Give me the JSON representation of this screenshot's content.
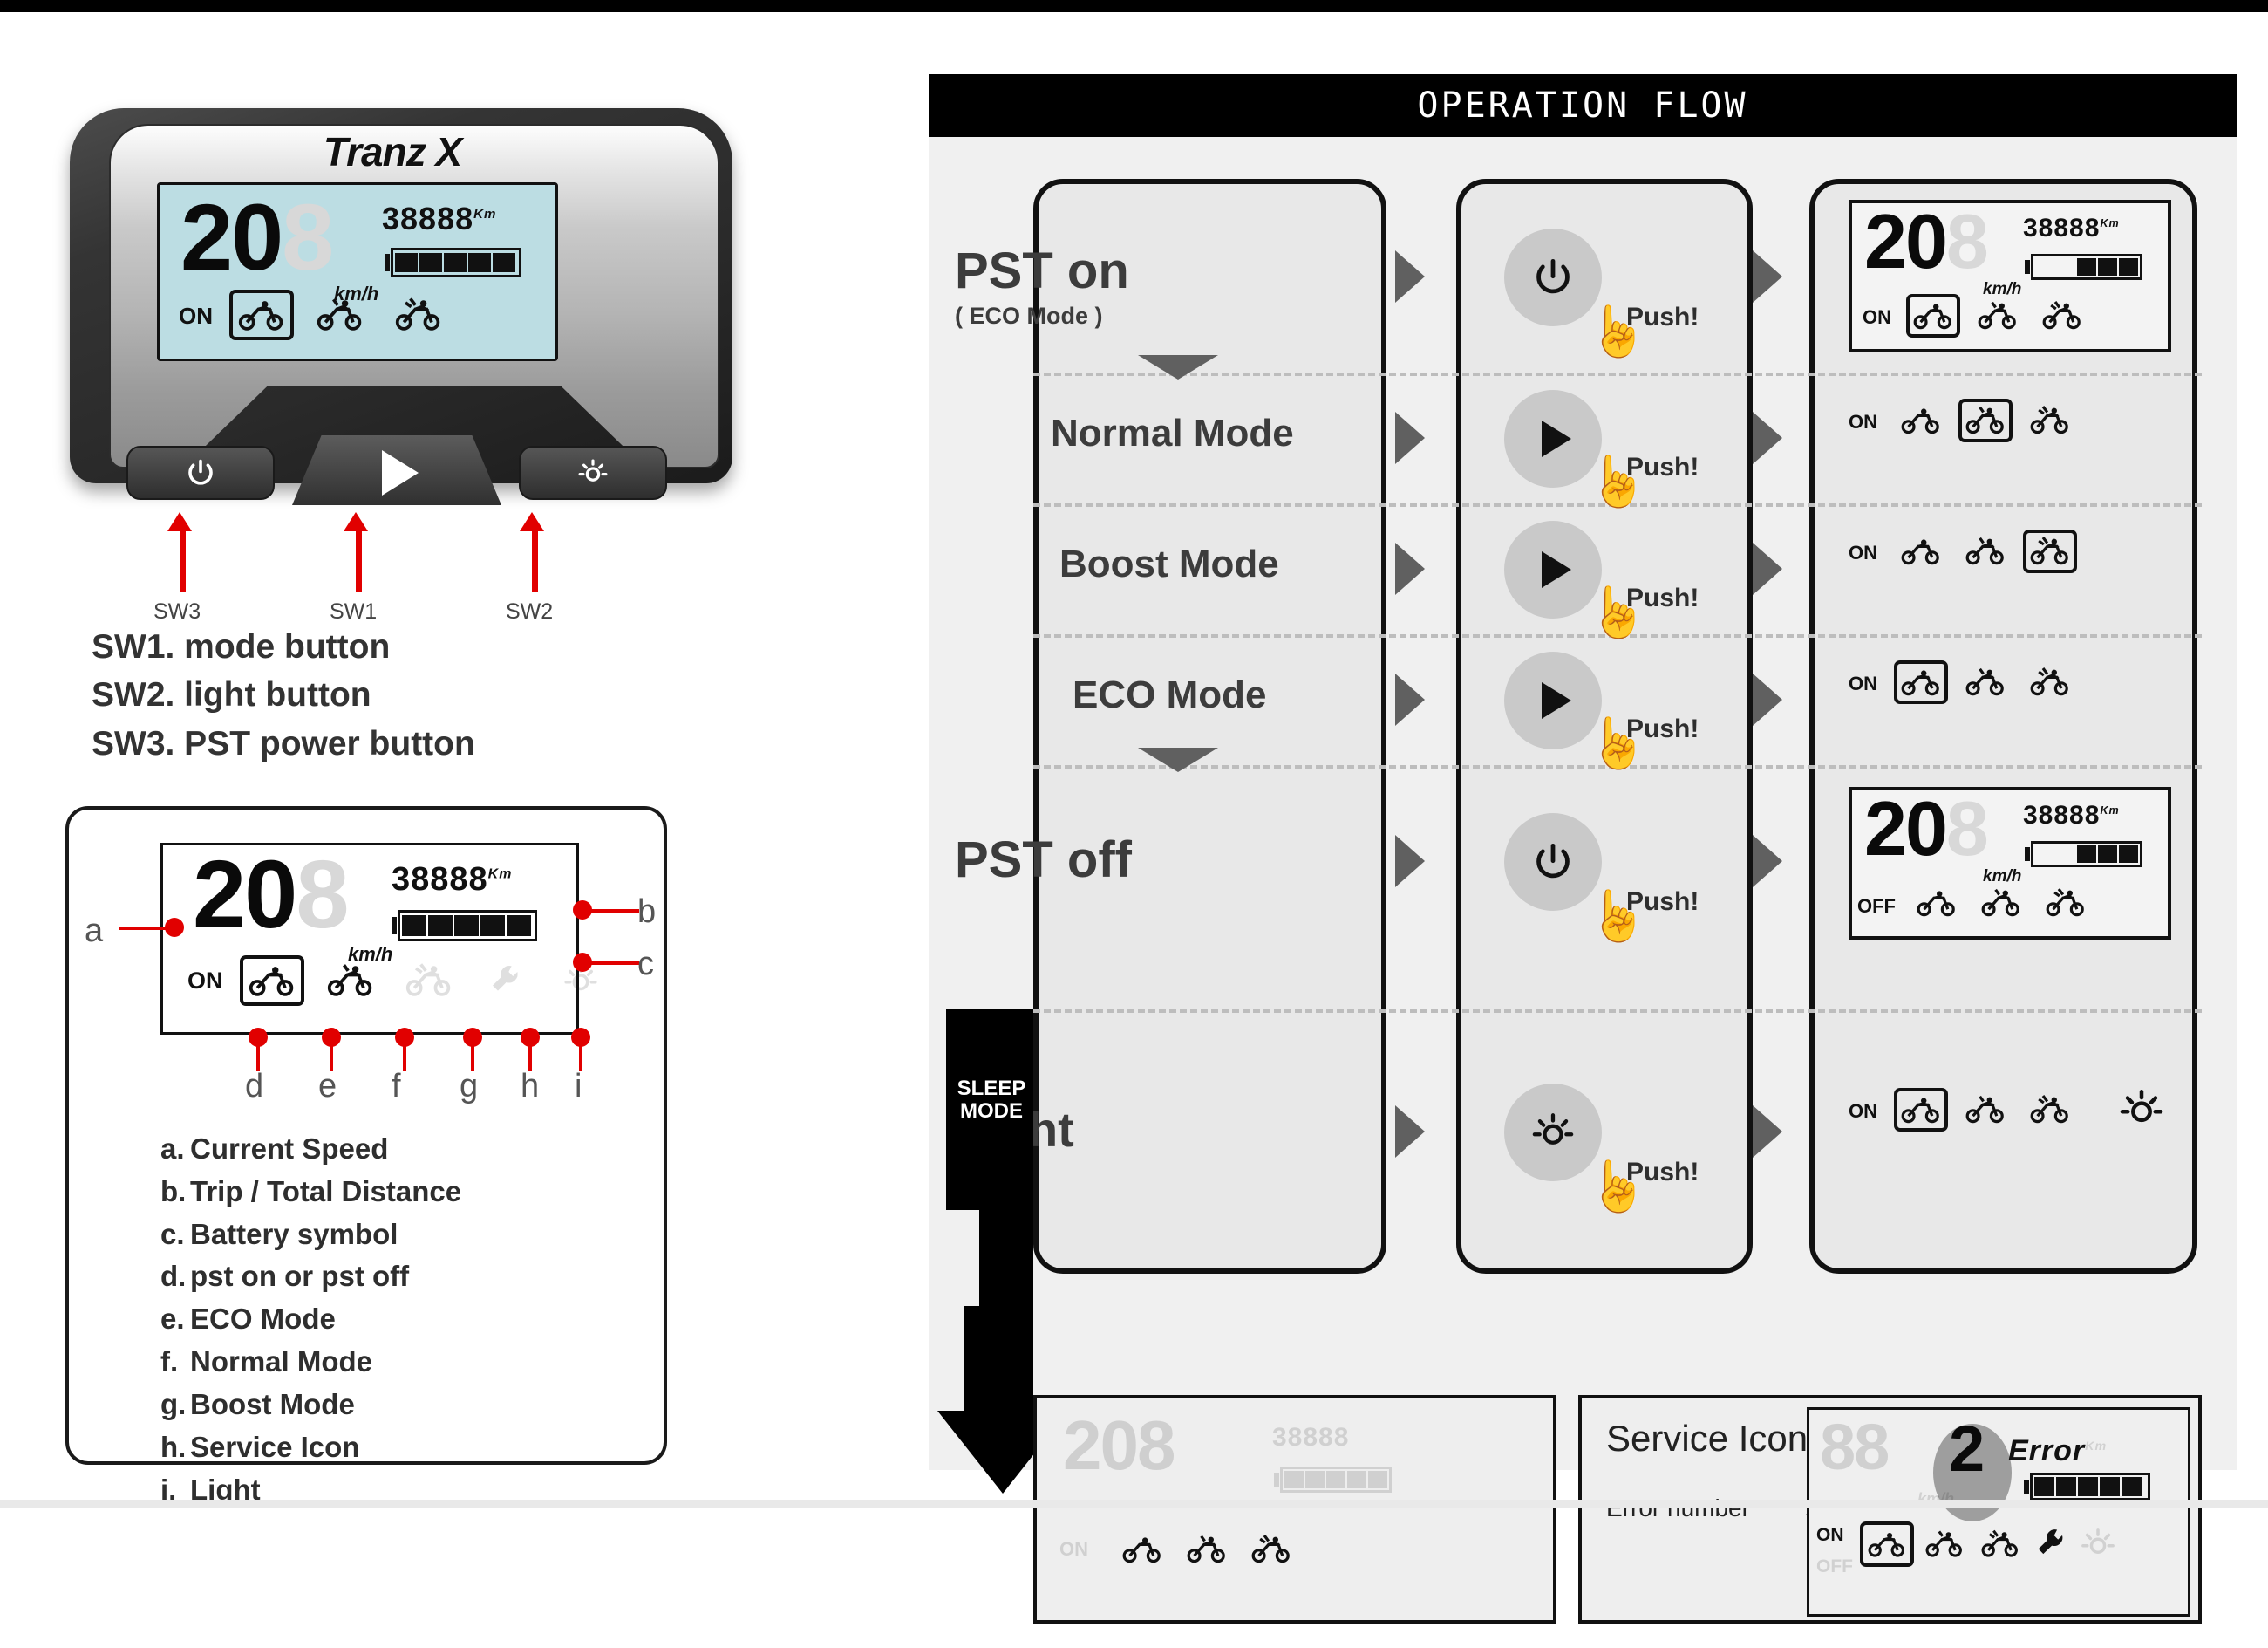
{
  "document": {
    "title": "Tranz X display operation guide"
  },
  "device": {
    "brand": "Tranz X",
    "lcd": {
      "speed": "20",
      "speed_ghost": "8",
      "speed_unit": "km/h",
      "odometer": "38888",
      "odometer_unit": "Km",
      "power_state": "ON",
      "battery_bars": 5,
      "battery_total": 5,
      "selected_bike_index": 0
    },
    "buttons": {
      "power_icon": "power-icon",
      "mode_icon": "play-triangle-icon",
      "light_icon": "light-bulb-icon"
    },
    "callouts": [
      {
        "id": "SW3",
        "label": "SW3"
      },
      {
        "id": "SW1",
        "label": "SW1"
      },
      {
        "id": "SW2",
        "label": "SW2"
      }
    ],
    "switch_list": [
      "SW1. mode button",
      "SW2. light button",
      "SW3. PST power button"
    ]
  },
  "legend_card": {
    "lcd": {
      "speed": "20",
      "speed_ghost": "8",
      "speed_unit": "km/h",
      "odometer": "38888",
      "odometer_unit": "Km",
      "power_state": "ON",
      "battery_bars": 5,
      "battery_total": 5,
      "selected_bike_index": 0
    },
    "markers": [
      "a",
      "b",
      "c",
      "d",
      "e",
      "f",
      "g",
      "h",
      "i"
    ],
    "items": [
      {
        "key": "a.",
        "text": "Current Speed"
      },
      {
        "key": "b.",
        "text": "Trip / Total Distance"
      },
      {
        "key": "c.",
        "text": "Battery symbol"
      },
      {
        "key": "d.",
        "text": "pst on or pst off"
      },
      {
        "key": "e.",
        "text": "ECO Mode"
      },
      {
        "key": "f.",
        "text": "Normal Mode"
      },
      {
        "key": "g.",
        "text": "Boost Mode"
      },
      {
        "key": "h.",
        "text": "Service Icon"
      },
      {
        "key": "i.",
        "text": "Light"
      }
    ]
  },
  "operation_flow": {
    "header": "OPERATION FLOW",
    "sleep_mode_label": "SLEEP\nMODE",
    "sleep_mode_line1": "SLEEP",
    "sleep_mode_line2": "MODE",
    "push_label": "Push!",
    "rows": [
      {
        "name": "pst-on",
        "label": "PST on",
        "sublabel": "( ECO Mode )",
        "button_icon": "power-icon",
        "push": "Push!",
        "display": {
          "full": true,
          "speed": "20",
          "speed_ghost": "8",
          "unit": "km/h",
          "odometer": "38888",
          "odometer_unit": "Km",
          "state": "ON",
          "battery_bars": 3,
          "battery_total": 5,
          "selected_bike_index": 0,
          "light": false
        }
      },
      {
        "name": "normal-mode",
        "label": "Normal Mode",
        "sublabel": "",
        "button_icon": "play-triangle-icon",
        "push": "Push!",
        "display": {
          "full": false,
          "state": "ON",
          "selected_bike_index": 1,
          "light": false
        }
      },
      {
        "name": "boost-mode",
        "label": "Boost Mode",
        "sublabel": "",
        "button_icon": "play-triangle-icon",
        "push": "Push!",
        "display": {
          "full": false,
          "state": "ON",
          "selected_bike_index": 2,
          "light": false
        }
      },
      {
        "name": "eco-mode",
        "label": "ECO Mode",
        "sublabel": "",
        "button_icon": "play-triangle-icon",
        "push": "Push!",
        "display": {
          "full": false,
          "state": "ON",
          "selected_bike_index": 0,
          "light": false
        }
      },
      {
        "name": "pst-off",
        "label": "PST off",
        "sublabel": "",
        "button_icon": "power-icon",
        "push": "Push!",
        "display": {
          "full": true,
          "speed": "20",
          "speed_ghost": "8",
          "unit": "km/h",
          "odometer": "38888",
          "odometer_unit": "Km",
          "state": "OFF",
          "battery_bars": 3,
          "battery_total": 5,
          "selected_bike_index": -1,
          "light": false
        }
      },
      {
        "name": "light",
        "label": "Light",
        "sublabel": "",
        "button_icon": "light-bulb-icon",
        "push": "Push!",
        "display": {
          "full": false,
          "state": "ON",
          "selected_bike_index": 0,
          "light": true
        }
      }
    ],
    "sleep_panel": {
      "name": "sleep-mode-display",
      "faded": true,
      "speed": "20",
      "speed_ghost": "8",
      "odometer": "38888",
      "state": "ON"
    },
    "service_panel": {
      "title": "Service Icon",
      "error_label": "Error number",
      "error_number": "2",
      "error_text": "Error",
      "unit": "Km",
      "speed_unit": "km/h",
      "state_on": "ON",
      "state_off": "OFF",
      "battery_bars": 5,
      "battery_total": 5,
      "selected_bike_index": 0,
      "wrench_icon": "wrench-icon",
      "light_icon": "light-bulb-icon"
    }
  },
  "colors": {
    "accent_red": "#e10000",
    "lcd_teal": "#bcdde3",
    "panel_grey": "#e8e8e8",
    "header_black": "#000000"
  }
}
